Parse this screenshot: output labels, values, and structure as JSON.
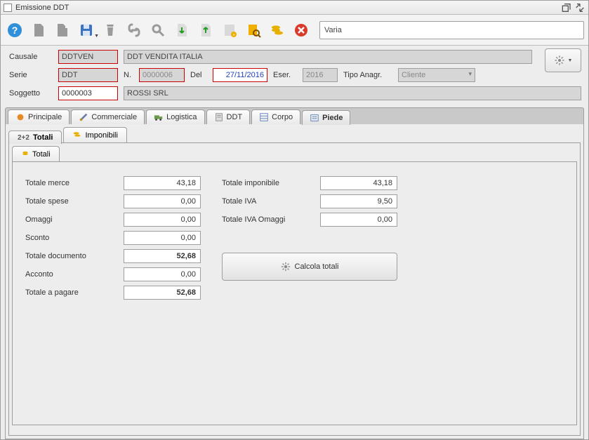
{
  "window": {
    "title": "Emissione DDT"
  },
  "status": "Varia",
  "header": {
    "labels": {
      "causale": "Causale",
      "serie": "Serie",
      "n": "N.",
      "del": "Del",
      "eser": "Eser.",
      "tipoanagr": "Tipo Anagr.",
      "soggetto": "Soggetto"
    },
    "causale_code": "DDTVEN",
    "causale_desc": "DDT VENDITA ITALIA",
    "serie": "DDT",
    "n": "0000006",
    "del": "27/11/2016",
    "eser": "2016",
    "tipoanagr": "Cliente",
    "soggetto_code": "0000003",
    "soggetto_desc": "ROSSI SRL"
  },
  "tabs1": {
    "principale": "Principale",
    "commerciale": "Commerciale",
    "logistica": "Logistica",
    "ddt": "DDT",
    "corpo": "Corpo",
    "piede": "Piede"
  },
  "tabs2": {
    "totali": "Totali",
    "imponibili": "Imponibili",
    "totali_prefix": "2+2"
  },
  "tabs3": {
    "totali": "Totali"
  },
  "totals": {
    "labels": {
      "totale_merce": "Totale merce",
      "totale_spese": "Totale spese",
      "omaggi": "Omaggi",
      "sconto": "Sconto",
      "totale_documento": "Totale documento",
      "acconto": "Acconto",
      "totale_a_pagare": "Totale a pagare",
      "totale_imponibile": "Totale imponibile",
      "totale_iva": "Totale IVA",
      "totale_iva_omaggi": "Totale IVA Omaggi",
      "calcola": "Calcola totali"
    },
    "totale_merce": "43,18",
    "totale_spese": "0,00",
    "omaggi": "0,00",
    "sconto": "0,00",
    "totale_documento": "52,68",
    "acconto": "0,00",
    "totale_a_pagare": "52,68",
    "totale_imponibile": "43,18",
    "totale_iva": "9,50",
    "totale_iva_omaggi": "0,00"
  }
}
